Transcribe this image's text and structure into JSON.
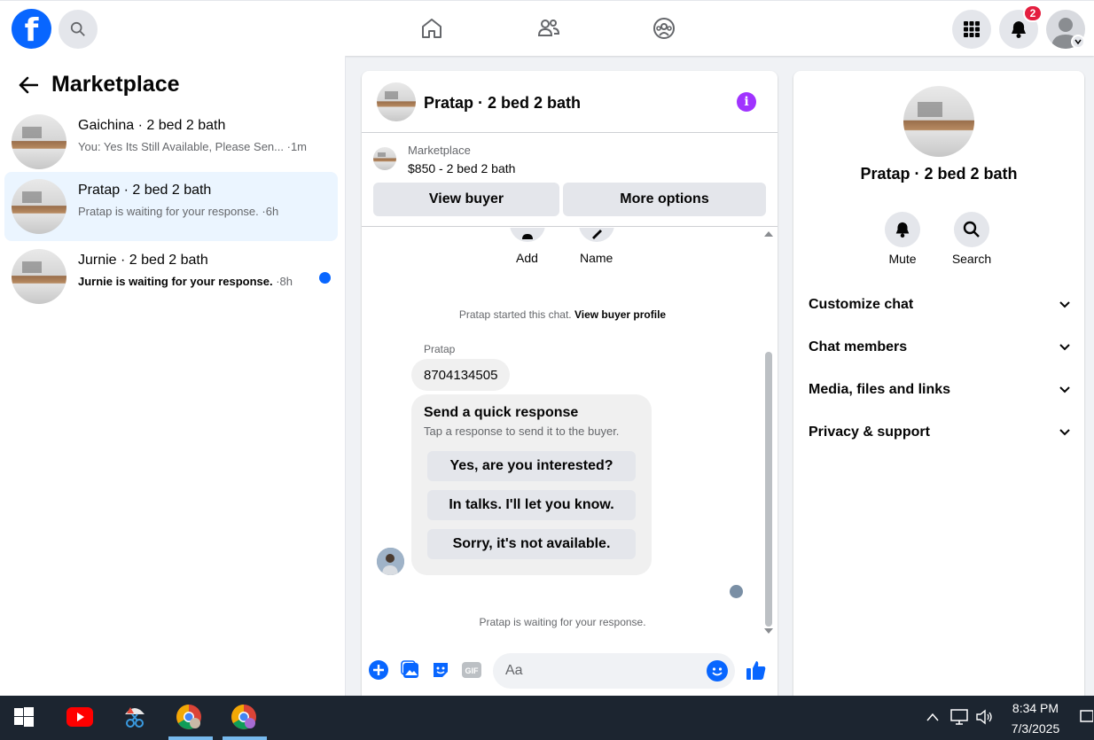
{
  "topbar": {
    "logo": "f",
    "notifications_count": "2"
  },
  "sidebar": {
    "title": "Marketplace",
    "conversations": [
      {
        "name": "Gaichina · 2 bed 2 bath",
        "preview": "You: Yes Its Still Available, Please Sen...",
        "time": " ·1m",
        "unread": false,
        "active": false
      },
      {
        "name": "Pratap · 2 bed 2 bath",
        "preview": "Pratap is waiting for your response.",
        "time": " ·6h",
        "unread": false,
        "active": true
      },
      {
        "name": "Jurnie · 2 bed 2 bath",
        "preview": "Jurnie is waiting for your response.",
        "time": " ·8h",
        "unread": true,
        "active": false
      }
    ]
  },
  "chat": {
    "title": "Pratap · 2 bed 2 bath",
    "listing_source": "Marketplace",
    "listing_price": "$850 - 2 bed 2 bath",
    "view_buyer": "View buyer",
    "more_options": "More options",
    "actions": [
      "Add",
      "Name"
    ],
    "started_text": "Pratap started this chat.",
    "view_profile": "View buyer profile",
    "sender": "Pratap",
    "message": "8704134505",
    "quick_title": "Send a quick response",
    "quick_sub": "Tap a response to send it to the buyer.",
    "quick_responses": [
      "Yes, are you interested?",
      "In talks. I'll let you know.",
      "Sorry, it's not available."
    ],
    "waiting_text": "Pratap is waiting for your response.",
    "input_placeholder": "Aa"
  },
  "info": {
    "name": "Pratap · 2 bed 2 bath",
    "mute": "Mute",
    "search": "Search",
    "sections": [
      "Customize chat",
      "Chat members",
      "Media, files and links",
      "Privacy & support"
    ]
  },
  "taskbar": {
    "time": "8:34 PM",
    "date": "7/3/2025"
  },
  "colors": {
    "brand": "#0866ff",
    "badge": "#e41e3f",
    "info_purple": "#a033ff",
    "active_conv": "#ebf5ff"
  }
}
